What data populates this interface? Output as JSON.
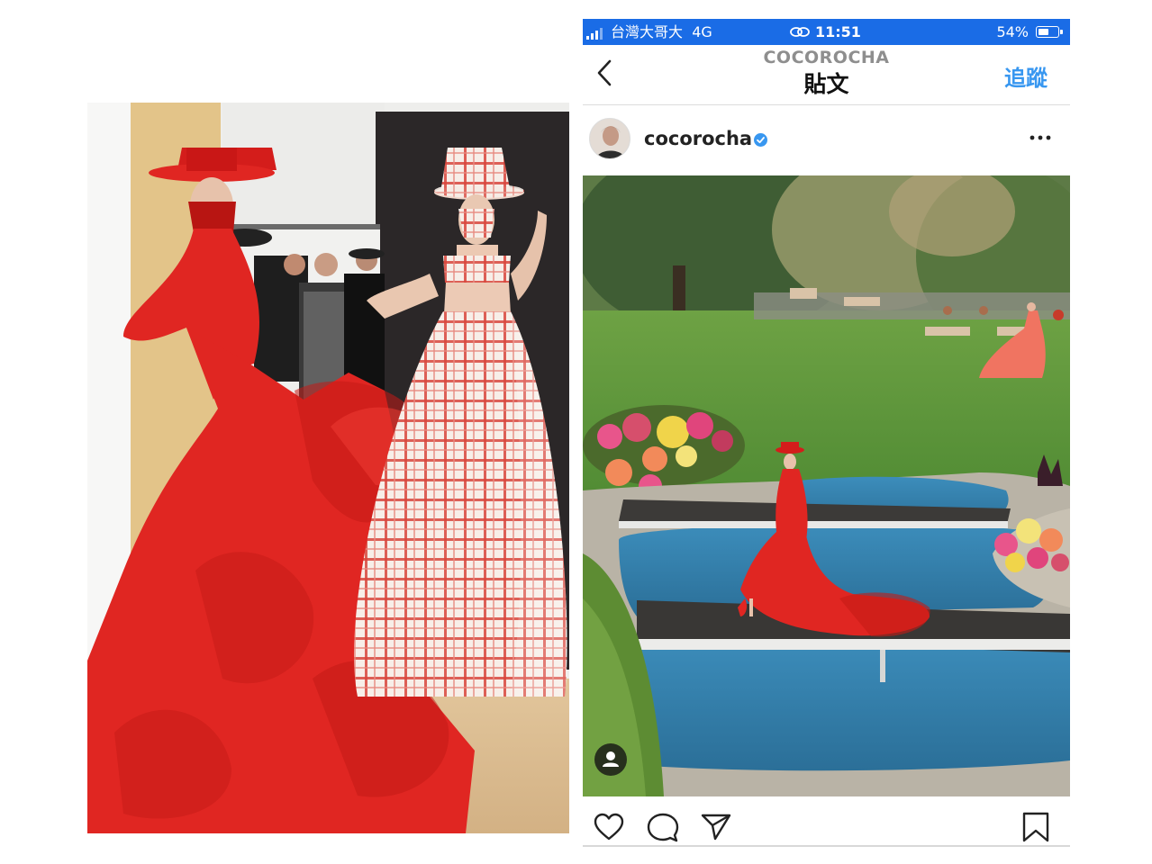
{
  "status_bar": {
    "carrier": "台灣大哥大",
    "network": "4G",
    "time": "11:51",
    "battery_percent": "54%",
    "bar_color": "#1a6ce6",
    "icons": [
      "signal-icon",
      "vpn-link-icon",
      "battery-icon"
    ]
  },
  "nav": {
    "account_name": "COCOROCHA",
    "title": "貼文",
    "follow_label": "追蹤",
    "back_icon": "chevron-left-icon",
    "link_color": "#3897f0"
  },
  "post": {
    "username": "cocorocha",
    "verified": true,
    "more_icon": "ellipsis-icon",
    "tag_icon": "person-tag-icon"
  },
  "actions": {
    "icons": [
      "heart-icon",
      "comment-icon",
      "share-icon",
      "bookmark-icon"
    ]
  },
  "colors": {
    "dress_red": "#e02622",
    "gingham_red": "#d9473c",
    "pool_blue": "#3a8ab5",
    "lawn_green": "#5f9a3c"
  }
}
